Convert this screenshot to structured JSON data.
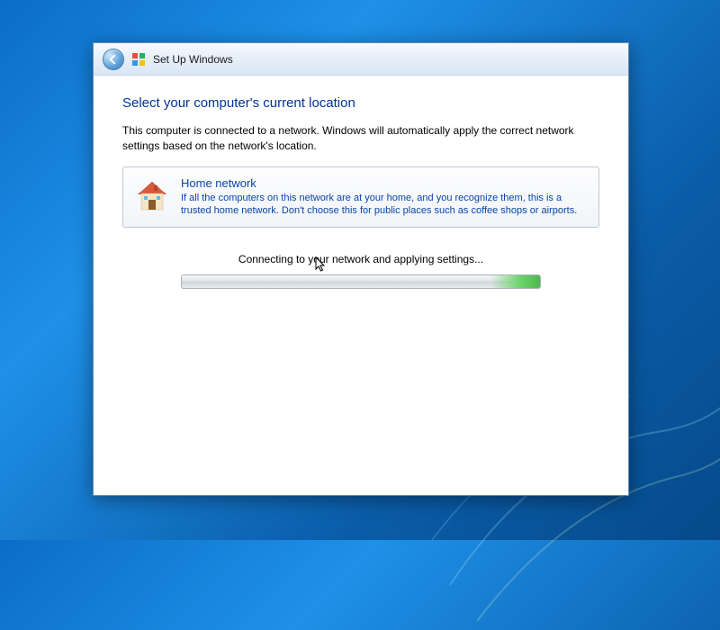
{
  "titlebar": {
    "title": "Set Up Windows"
  },
  "heading": "Select your computer's current location",
  "subtext": "This computer is connected to a network. Windows will automatically apply the correct network settings based on the network's location.",
  "option": {
    "title": "Home network",
    "description": "If all the computers on this network are at your home, and you recognize them, this is a trusted home network.  Don't choose this for public places such as coffee shops or airports."
  },
  "status": "Connecting to your network and applying settings..."
}
